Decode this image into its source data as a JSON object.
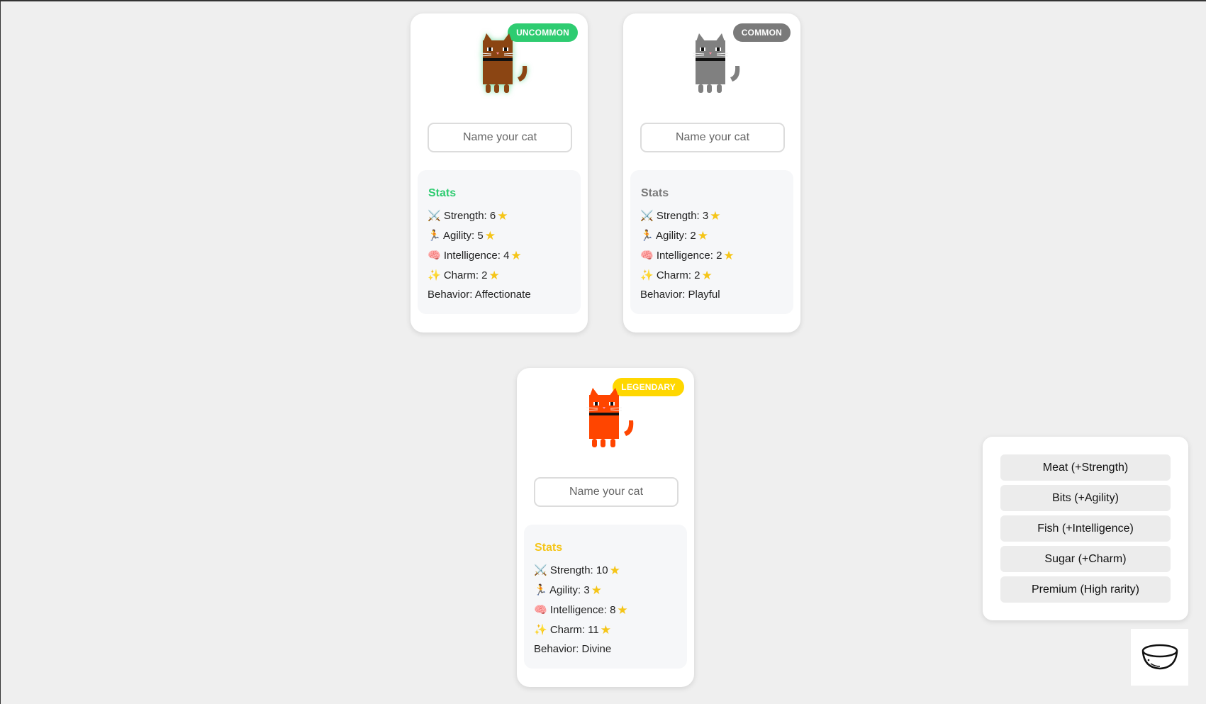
{
  "cats": [
    {
      "rarity": "UNCOMMON",
      "rarity_color": "#2ecc71",
      "fur_color": "#8b4513",
      "name_placeholder": "Name your cat",
      "stats_title": "Stats",
      "strength": "⚔️ Strength: 6",
      "agility": "🏃 Agility: 5",
      "intelligence": "🧠 Intelligence: 4",
      "charm": "✨ Charm: 2",
      "behavior": "Behavior: Affectionate"
    },
    {
      "rarity": "COMMON",
      "rarity_color": "#7a7a7a",
      "fur_color": "#808080",
      "name_placeholder": "Name your cat",
      "stats_title": "Stats",
      "strength": "⚔️ Strength: 3",
      "agility": "🏃 Agility: 2",
      "intelligence": "🧠 Intelligence: 2",
      "charm": "✨ Charm: 2",
      "behavior": "Behavior: Playful"
    },
    {
      "rarity": "LEGENDARY",
      "rarity_color": "#ffd700",
      "fur_color": "#ff4500",
      "name_placeholder": "Name your cat",
      "stats_title": "Stats",
      "strength": "⚔️ Strength: 10",
      "agility": "🏃 Agility: 3",
      "intelligence": "🧠 Intelligence: 8",
      "charm": "✨ Charm: 11",
      "behavior": "Behavior: Divine"
    }
  ],
  "star_glyph": "★",
  "food_menu": {
    "items": [
      "Meat (+Strength)",
      "Bits (+Agility)",
      "Fish (+Intelligence)",
      "Sugar (+Charm)",
      "Premium (High rarity)"
    ]
  },
  "bowl_icon": "bowl-icon"
}
